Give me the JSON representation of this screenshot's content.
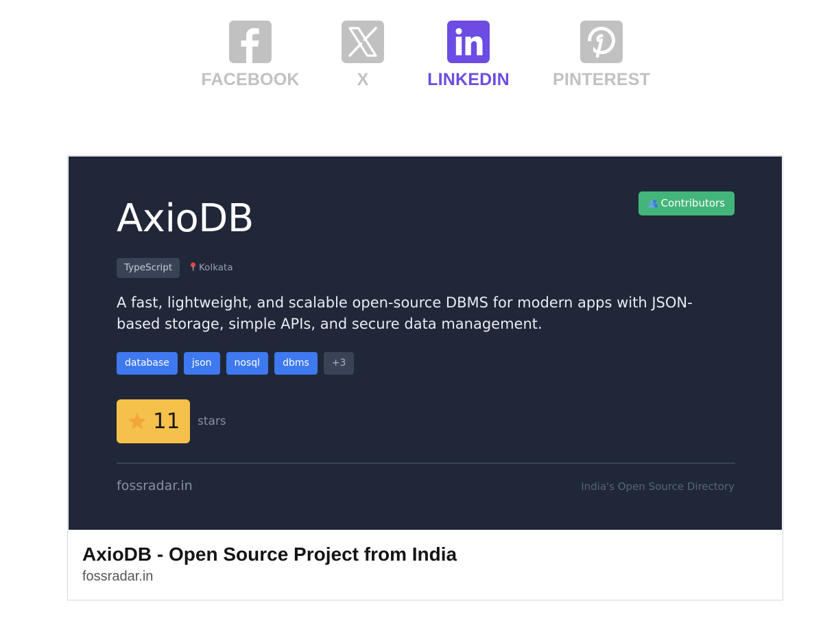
{
  "share": {
    "items": [
      {
        "label": "FACEBOOK",
        "icon": "facebook-icon",
        "active": false
      },
      {
        "label": "X",
        "icon": "x-icon",
        "active": false
      },
      {
        "label": "LINKEDIN",
        "icon": "linkedin-icon",
        "active": true
      },
      {
        "label": "PINTEREST",
        "icon": "pinterest-icon",
        "active": false
      }
    ],
    "colors": {
      "inactive": "#c1c1c1",
      "active": "#6c4ce3"
    }
  },
  "preview": {
    "image": {
      "title": "AxioDB",
      "contributors_label": "Contributors",
      "language": "TypeScript",
      "location": "Kolkata",
      "description": "A fast, lightweight, and scalable open-source DBMS for modern apps with JSON-based storage, simple APIs, and secure data management.",
      "tags": [
        "database",
        "json",
        "nosql",
        "dbms"
      ],
      "more_tags": "+3",
      "stars_count": "11",
      "stars_label": "stars",
      "site": "fossradar.in",
      "tagline": "India's Open Source Directory",
      "colors": {
        "background": "#1f2738",
        "tag": "#3f79f0",
        "contributors": "#44b57a",
        "stars": "#f5c14a"
      }
    },
    "title": "AxioDB - Open Source Project from India",
    "domain": "fossradar.in"
  }
}
